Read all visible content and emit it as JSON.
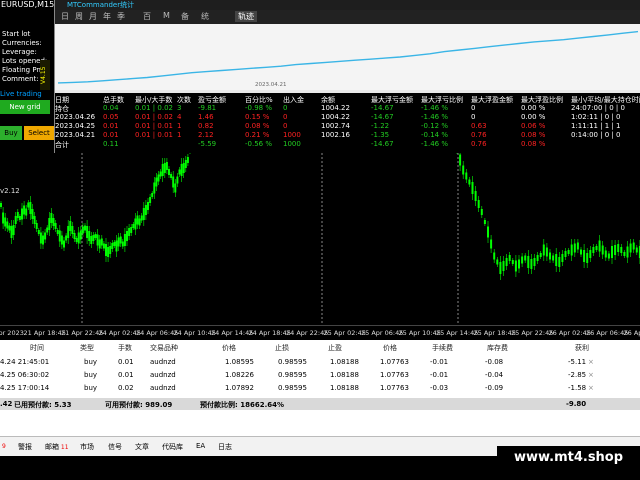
{
  "symbol_title": "EURUSD,M15",
  "side_info": [
    "Start lot",
    "Currencies:",
    "Leverage:",
    "Lots opened:",
    "Floating PnL:",
    "Comment:"
  ],
  "live_trading": "Live trading",
  "buttons": {
    "new_grid": "New grid",
    "buy": "Buy",
    "select": "Select"
  },
  "vtag": "V4.15",
  "price_label": "v2.12",
  "mtc": {
    "title": "MTCommander统计",
    "toolbar": [
      "日",
      "周",
      "月",
      "年",
      "季",
      "百",
      "M",
      "备",
      "统",
      "轨迹"
    ],
    "selected_tab": "轨迹",
    "date_label": "2023.04.21",
    "equity_curve": [
      0.02,
      0.03,
      0.04,
      0.06,
      0.08,
      0.1,
      0.12,
      0.15,
      0.18,
      0.21,
      0.23,
      0.25,
      0.27,
      0.29,
      0.31,
      0.33,
      0.36,
      0.38,
      0.4,
      0.42,
      0.44,
      0.46,
      0.48,
      0.5,
      0.53,
      0.56,
      0.6,
      0.63,
      0.66,
      0.69,
      0.72,
      0.75,
      0.78,
      0.8,
      0.82,
      0.85,
      0.88,
      0.91,
      0.94,
      0.97
    ]
  },
  "stats": {
    "headers": [
      "日期",
      "总手数",
      "最小/大手数",
      "次数",
      "盈亏金额",
      "百分比%",
      "出入金",
      "余额",
      "最大浮亏金额",
      "最大浮亏比例",
      "最大浮盈金额",
      "最大浮盈比例",
      "最小/平均/最大持仓时间"
    ],
    "rows": [
      {
        "cells": [
          "持仓",
          "0.04",
          "0.01 | 0.02",
          "3",
          "-9.81",
          "-0.98 %",
          "0",
          "1004.22",
          "-14.67",
          "-1.46 %",
          "0",
          "0.00 %",
          "24:07:00 | 0 | 0"
        ],
        "color": "green"
      },
      {
        "cells": [
          "2023.04.26",
          "0.05",
          "0.01 | 0.02",
          "4",
          "1.46",
          "0.15 %",
          "0",
          "1004.22",
          "-14.67",
          "-1.46 %",
          "0",
          "0.00 %",
          "1:02:11 | 0 | 0"
        ],
        "color": "red"
      },
      {
        "cells": [
          "2023.04.25",
          "0.01",
          "0.01 | 0.01",
          "1",
          "0.82",
          "0.08 %",
          "0",
          "1002.74",
          "-1.22",
          "-0.12 %",
          "0.63",
          "0.06 %",
          "1:11:11 | 1 | 1"
        ],
        "color": "red"
      },
      {
        "cells": [
          "2023.04.21",
          "0.01",
          "0.01 | 0.01",
          "1",
          "2.12",
          "0.21 %",
          "1000",
          "1002.16",
          "-1.35",
          "-0.14 %",
          "0.76",
          "0.08 %",
          "0:14:00 | 0 | 0"
        ],
        "color": "red"
      },
      {
        "cells": [
          "合计",
          "0.11",
          "",
          "",
          "-5.59",
          "-0.56 %",
          "1000",
          "",
          "-14.67",
          "-1.46 %",
          "0.76",
          "0.08 %",
          ""
        ],
        "color": "green"
      }
    ]
  },
  "x_axis": [
    "Apr 2023",
    "21 Apr 18:45",
    "21 Apr 22:45",
    "24 Apr 02:45",
    "24 Apr 06:45",
    "24 Apr 10:45",
    "24 Apr 14:45",
    "24 Apr 18:45",
    "24 Apr 22:45",
    "25 Apr 02:45",
    "25 Apr 06:45",
    "25 Apr 10:45",
    "25 Apr 14:45",
    "25 Apr 18:45",
    "25 Apr 22:45",
    "26 Apr 02:45",
    "26 Apr 06:45",
    "26 Apr 10:45"
  ],
  "table": {
    "headers": [
      "时间",
      "类型",
      "手数",
      "交易品种",
      "价格",
      "止损",
      "止盈",
      "价格",
      "手续费",
      "库存费",
      "获利"
    ],
    "rows": [
      [
        "4.24 21:45:01",
        "buy",
        "0.01",
        "audnzd",
        "1.08595",
        "0.98595",
        "1.08188",
        "1.07763",
        "-0.01",
        "-0.08",
        "-5.11"
      ],
      [
        "4.25 06:30:02",
        "buy",
        "0.01",
        "audnzd",
        "1.08226",
        "0.98595",
        "1.08188",
        "1.07763",
        "-0.01",
        "-0.04",
        "-2.85"
      ],
      [
        "4.25 17:00:14",
        "buy",
        "0.02",
        "audnzd",
        "1.07892",
        "0.98595",
        "1.08188",
        "1.07763",
        "-0.03",
        "-0.09",
        "-1.58"
      ]
    ],
    "summary": {
      "balance": ".42",
      "credit_label": "已用预付款: 5.33",
      "free_label": "可用预付款: 989.09",
      "level_label": "预付款比例: 18662.64%",
      "total": "-9.80"
    }
  },
  "tabs": [
    {
      "label": "9",
      "badge": ""
    },
    {
      "label": "警报",
      "badge": ""
    },
    {
      "label": "邮箱",
      "badge": "11"
    },
    {
      "label": "市场",
      "badge": ""
    },
    {
      "label": "信号",
      "badge": ""
    },
    {
      "label": "文章",
      "badge": ""
    },
    {
      "label": "代码库",
      "badge": ""
    },
    {
      "label": "EA",
      "badge": ""
    },
    {
      "label": "日志",
      "badge": ""
    }
  ],
  "brand": "www.mt4.shop",
  "close_glyph": "×",
  "colors": {
    "candle": "#00ff00",
    "equity": "#3ab5e6",
    "accent": "#ff8c00"
  }
}
